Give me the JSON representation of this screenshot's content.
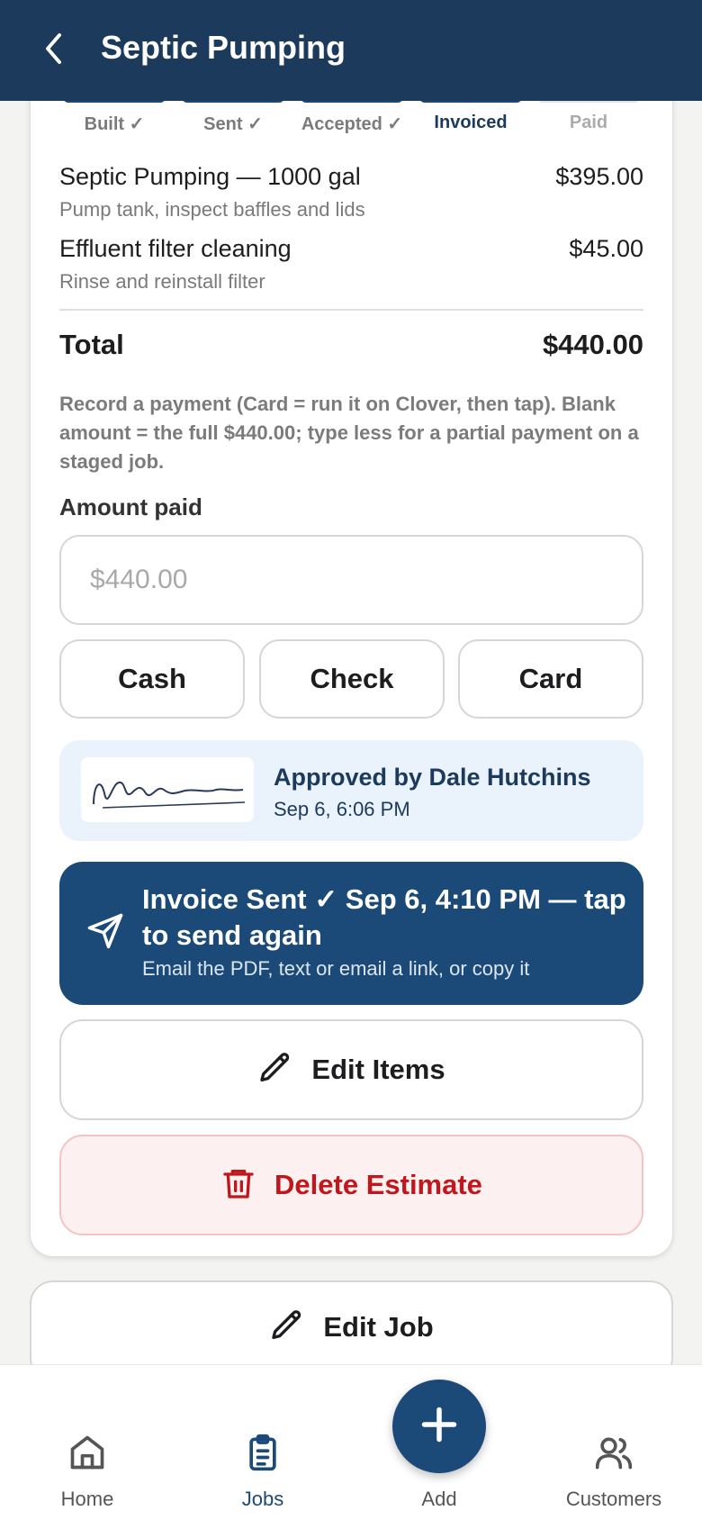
{
  "header": {
    "title": "Septic Pumping"
  },
  "progress": {
    "steps": [
      {
        "label": "Built ✓",
        "state": "done"
      },
      {
        "label": "Sent ✓",
        "state": "done"
      },
      {
        "label": "Accepted ✓",
        "state": "done"
      },
      {
        "label": "Invoiced",
        "state": "current"
      },
      {
        "label": "Paid",
        "state": "todo"
      }
    ]
  },
  "line_items": [
    {
      "name": "Septic Pumping — 1000 gal",
      "description": "Pump tank, inspect baffles and lids",
      "price": "$395.00"
    },
    {
      "name": "Effluent filter cleaning",
      "description": "Rinse and reinstall filter",
      "price": "$45.00"
    }
  ],
  "total": {
    "label": "Total",
    "value": "$440.00"
  },
  "payment": {
    "note": "Record a payment (Card = run it on Clover, then tap). Blank amount = the full $440.00; type less for a partial payment on a staged job.",
    "amount_label": "Amount paid",
    "amount_placeholder": "$440.00",
    "methods": [
      "Cash",
      "Check",
      "Card"
    ]
  },
  "approval": {
    "title": "Approved by Dale Hutchins",
    "date": "Sep 6, 6:06 PM"
  },
  "send_invoice": {
    "title": "Invoice Sent ✓ Sep 6, 4:10 PM — tap to send again",
    "subtitle": "Email the PDF, text or email a link, or copy it"
  },
  "actions": {
    "edit_items": "Edit Items",
    "delete_estimate": "Delete Estimate",
    "edit_job": "Edit Job"
  },
  "bottom_nav": {
    "items": [
      {
        "label": "Home",
        "icon": "home-icon",
        "active": false
      },
      {
        "label": "Jobs",
        "icon": "clipboard-icon",
        "active": true
      },
      {
        "label": "Add",
        "icon": "plus-icon",
        "active": false
      },
      {
        "label": "Customers",
        "icon": "users-icon",
        "active": false
      }
    ]
  },
  "colors": {
    "primary": "#1b3a5c",
    "accent": "#1b4a78",
    "danger": "#c0171c",
    "approval_bg": "#eaf2fb"
  }
}
